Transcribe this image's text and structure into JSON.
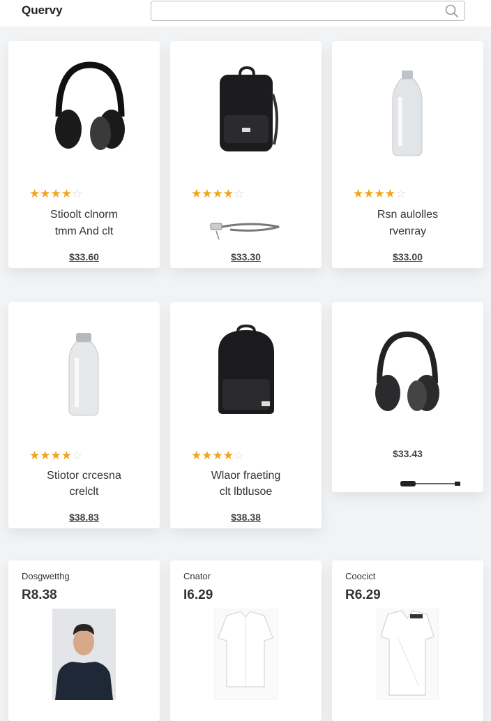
{
  "header": {
    "brand": "Quervy",
    "search_value": ""
  },
  "icons": {
    "search": "search-icon",
    "star": "star-icon"
  },
  "colors": {
    "star": "#f4a418",
    "card_bg": "#ffffff",
    "page_bg": "#f2f3f5"
  },
  "products": [
    {
      "rating": 4,
      "title_lines": [
        "Stioolt clnorm",
        "tmm And clt"
      ],
      "price": "$33.60",
      "image": "headphones"
    },
    {
      "rating": 4,
      "title_lines": [],
      "price": "$33.30",
      "image": "backpack-with-cable"
    },
    {
      "rating": 4,
      "title_lines": [
        "Rsn aulolles",
        "rvenray"
      ],
      "price": "$33.00",
      "image": "bottle"
    },
    {
      "rating": 4,
      "title_lines": [
        "Stiotor crcesna",
        "crelclt"
      ],
      "price": "$38.83",
      "image": "bottle"
    },
    {
      "rating": 4,
      "title_lines": [
        "Wlaor fraeting",
        "clt lbtlusoe"
      ],
      "price": "$38.38",
      "image": "backpack"
    },
    {
      "price": "$33.43",
      "image": "headphones-with-cable"
    }
  ],
  "apparel": [
    {
      "label": "Dosgwetthg",
      "price": "R8.38",
      "image": "man-in-tshirt"
    },
    {
      "label": "Cnator",
      "price": "I6.29",
      "image": "white-shirt"
    },
    {
      "label": "Coocict",
      "price": "R6.29",
      "image": "white-shirt"
    }
  ]
}
